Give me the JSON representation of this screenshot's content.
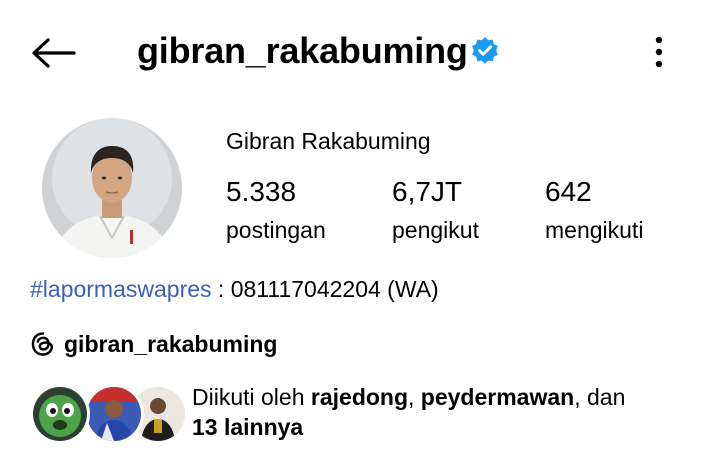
{
  "header": {
    "username": "gibran_rakabuming",
    "icons": {
      "back": "arrow-left-icon",
      "verified": "verified-badge-icon",
      "more": "more-vertical-icon"
    }
  },
  "profile": {
    "display_name": "Gibran Rakabuming",
    "stats": [
      {
        "value": "5.338",
        "label": "postingan"
      },
      {
        "value": "6,7JT",
        "label": "pengikut"
      },
      {
        "value": "642",
        "label": "mengikuti"
      }
    ]
  },
  "bio": {
    "hashtag": "#lapormaswapres",
    "text": " : 081117042204 (WA)"
  },
  "threads": {
    "handle": "gibran_rakabuming",
    "icon": "threads-icon"
  },
  "followed_by": {
    "prefix": "Diikuti oleh ",
    "user1": "rajedong",
    "sep": ", ",
    "user2": "peydermawan",
    "mid": ", dan ",
    "others": "13 lainnya"
  },
  "colors": {
    "link": "#3b5fb8",
    "verified": "#1d9bf0"
  }
}
